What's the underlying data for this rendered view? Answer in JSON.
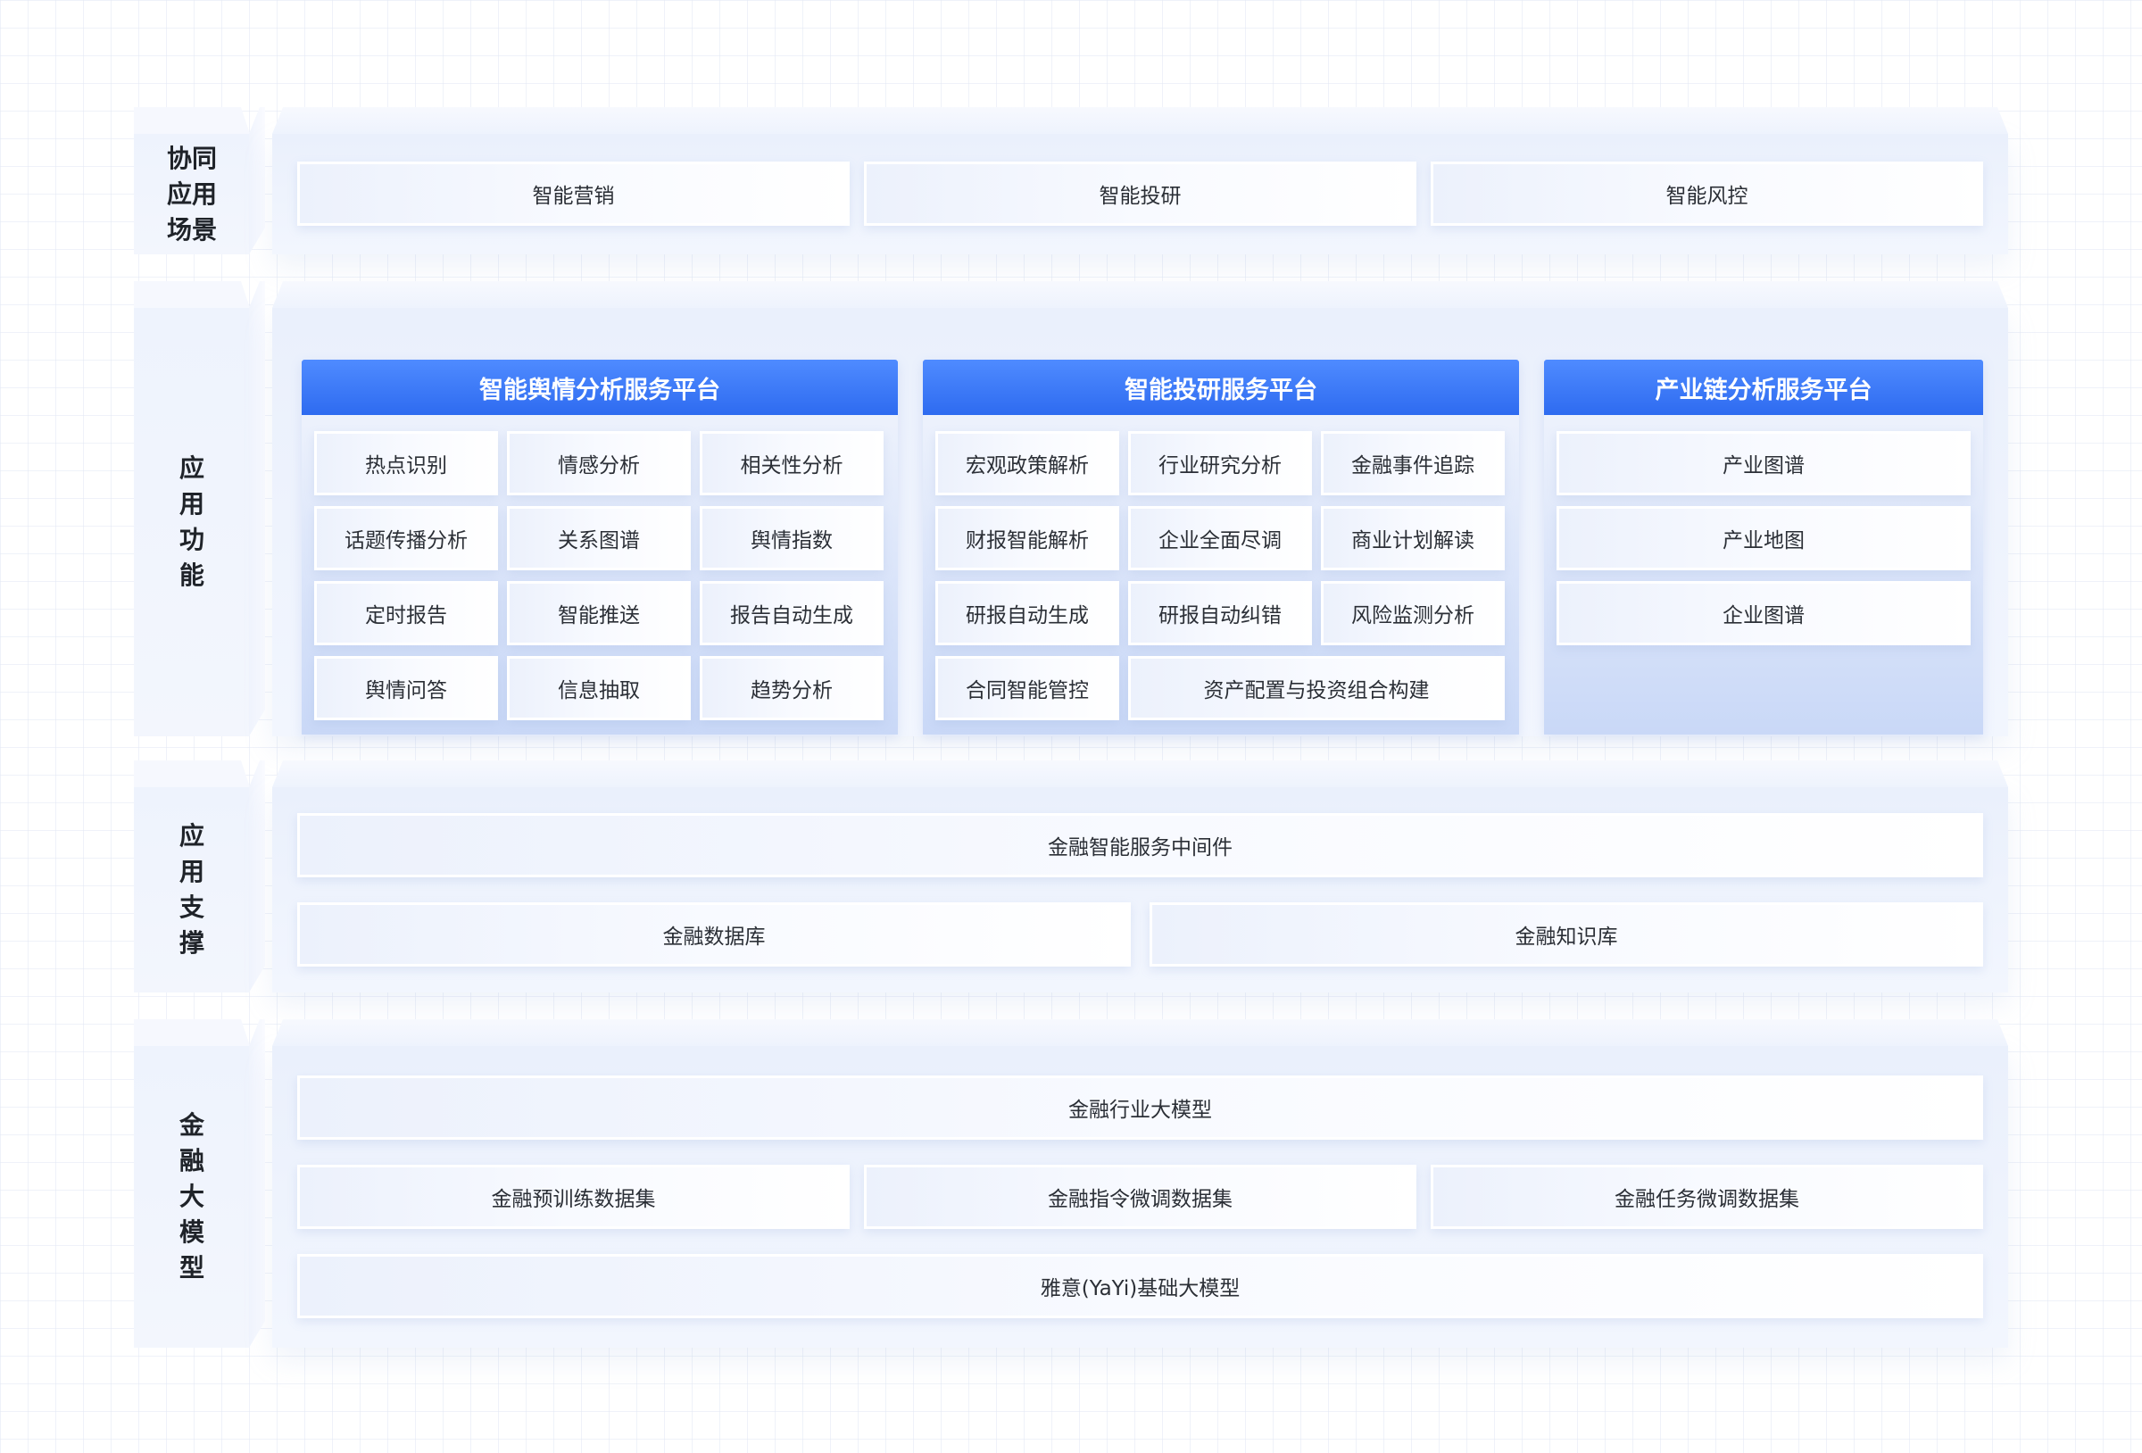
{
  "layers": {
    "scenario": {
      "label": [
        "协同",
        "应用",
        "场景"
      ],
      "items": [
        "智能营销",
        "智能投研",
        "智能风控"
      ]
    },
    "function": {
      "label": [
        "应",
        "用",
        "功",
        "能"
      ],
      "platforms": [
        {
          "title": "智能舆情分析服务平台",
          "items": [
            "热点识别",
            "情感分析",
            "相关性分析",
            "话题传播分析",
            "关系图谱",
            "舆情指数",
            "定时报告",
            "智能推送",
            "报告自动生成",
            "舆情问答",
            "信息抽取",
            "趋势分析"
          ]
        },
        {
          "title": "智能投研服务平台",
          "items": [
            "宏观政策解析",
            "行业研究分析",
            "金融事件追踪",
            "财报智能解析",
            "企业全面尽调",
            "商业计划解读",
            "研报自动生成",
            "研报自动纠错",
            "风险监测分析",
            "合同智能管控",
            "资产配置与投资组合构建"
          ]
        },
        {
          "title": "产业链分析服务平台",
          "items": [
            "产业图谱",
            "产业地图",
            "企业图谱"
          ]
        }
      ]
    },
    "support": {
      "label": [
        "应",
        "用",
        "支",
        "撑"
      ],
      "middleware": "金融智能服务中间件",
      "items": [
        "金融数据库",
        "金融知识库"
      ]
    },
    "model": {
      "label": [
        "金",
        "融",
        "大",
        "模",
        "型"
      ],
      "industry_model": "金融行业大模型",
      "datasets": [
        "金融预训练数据集",
        "金融指令微调数据集",
        "金融任务微调数据集"
      ],
      "base_model": "雅意(YaYi)基础大模型"
    }
  }
}
